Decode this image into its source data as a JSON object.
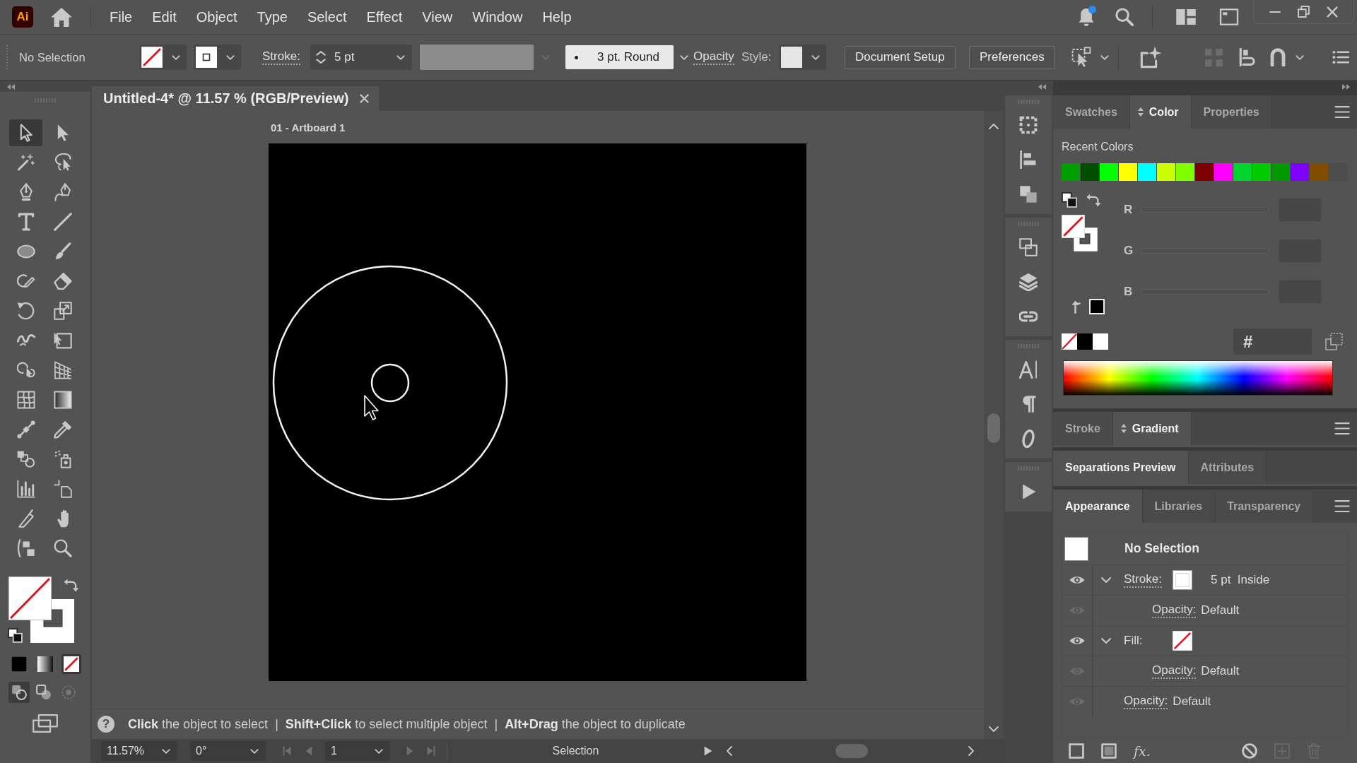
{
  "app_logo": "Ai",
  "menu_bar": {
    "items": [
      "File",
      "Edit",
      "Object",
      "Type",
      "Select",
      "Effect",
      "View",
      "Window",
      "Help"
    ]
  },
  "notifications": {
    "unread": true
  },
  "control_bar": {
    "selection": "No Selection",
    "stroke_label": "Stroke:",
    "stroke_weight": "5 pt",
    "brush": "3 pt. Round",
    "opacity_label": "Opacity",
    "style_label": "Style:",
    "buttons": [
      "Document Setup",
      "Preferences"
    ]
  },
  "document_tab": {
    "title": "Untitled-4* @ 11.57 % (RGB/Preview)"
  },
  "tools": [
    {
      "kind": "selection",
      "selected": true
    },
    {
      "kind": "direct_selection",
      "selected": false
    },
    {
      "kind": "magic_wand",
      "selected": false
    },
    {
      "kind": "lasso",
      "selected": false
    },
    {
      "kind": "pen",
      "selected": false
    },
    {
      "kind": "curvature",
      "selected": false
    },
    {
      "kind": "type",
      "selected": false
    },
    {
      "kind": "line",
      "selected": false
    },
    {
      "kind": "ellipse",
      "selected": false
    },
    {
      "kind": "paintbrush",
      "selected": false
    },
    {
      "kind": "shaper",
      "selected": false
    },
    {
      "kind": "eraser",
      "selected": false
    },
    {
      "kind": "rotate",
      "selected": false
    },
    {
      "kind": "scale",
      "selected": false
    },
    {
      "kind": "warp",
      "selected": false
    },
    {
      "kind": "free_transform",
      "selected": false
    },
    {
      "kind": "shape_builder",
      "selected": false
    },
    {
      "kind": "perspective_grid",
      "selected": false
    },
    {
      "kind": "mesh",
      "selected": false
    },
    {
      "kind": "gradient",
      "selected": false
    },
    {
      "kind": "width",
      "selected": false
    },
    {
      "kind": "eyedropper",
      "selected": false
    },
    {
      "kind": "blend",
      "selected": false
    },
    {
      "kind": "symbol_sprayer",
      "selected": false
    },
    {
      "kind": "column_graph",
      "selected": false
    },
    {
      "kind": "artboard",
      "selected": false
    },
    {
      "kind": "slice",
      "selected": false
    },
    {
      "kind": "hand",
      "selected": false
    },
    {
      "kind": "edit_toolbar",
      "selected": false
    },
    {
      "kind": "zoom",
      "selected": false
    }
  ],
  "color_modes": [
    {
      "kind": "color",
      "selected": false
    },
    {
      "kind": "gradient",
      "selected": false
    },
    {
      "kind": "none",
      "selected": true
    }
  ],
  "draw_modes": [
    {
      "kind": "normal",
      "selected": true
    },
    {
      "kind": "behind",
      "selected": false
    },
    {
      "kind": "inside",
      "selected": false
    }
  ],
  "artboard": {
    "label": "01 - Artboard 1"
  },
  "hint_bar": {
    "icon": "?",
    "text": "**Click** the object to select  |  **Shift+Click** to select multiple object  |  **Alt+Drag** the object to duplicate"
  },
  "status_bar": {
    "zoom": "11.57%",
    "rotation": "0°",
    "artboard": "1",
    "tool": "Selection"
  },
  "panels": [
    {
      "kind": "color",
      "has_menu": true,
      "tabs": [
        {
          "label": "Swatches",
          "selected": false,
          "options_toggle": false
        },
        {
          "label": "Color",
          "selected": true,
          "options_toggle": true
        },
        {
          "label": "Properties",
          "selected": false,
          "options_toggle": false
        }
      ],
      "recent_colors_label": "Recent Colors",
      "recent_colors": [
        {
          "color": "#009e00"
        },
        {
          "color": "#004d00"
        },
        {
          "color": "#00ff00"
        },
        {
          "color": "#ffff00"
        },
        {
          "color": "#00ffff"
        },
        {
          "color": "#ccff00"
        },
        {
          "color": "#80ff00"
        },
        {
          "color": "#800000"
        },
        {
          "color": "#ff00ff"
        },
        {
          "color": "#00d42e"
        },
        {
          "color": "#00cc00"
        },
        {
          "color": "#009900"
        },
        {
          "color": "#8000ff"
        },
        {
          "color": "#804d00"
        }
      ],
      "channels": [
        {
          "label": "R",
          "disabled": true
        },
        {
          "label": "G",
          "disabled": true
        },
        {
          "label": "B",
          "disabled": true
        }
      ],
      "hex_prefix": "#"
    },
    {
      "kind": "tabs_only",
      "has_menu": true,
      "tabs": [
        {
          "label": "Stroke",
          "selected": false,
          "options_toggle": false
        },
        {
          "label": "Gradient",
          "selected": true,
          "options_toggle": true
        }
      ]
    },
    {
      "kind": "tabs_only",
      "tabs": [
        {
          "label": "Separations Preview",
          "selected": true,
          "options_toggle": false
        },
        {
          "label": "Attributes",
          "selected": false,
          "options_toggle": false
        }
      ]
    },
    {
      "kind": "appearance",
      "has_menu": true,
      "tabs": [
        {
          "label": "Appearance",
          "selected": true,
          "options_toggle": false
        },
        {
          "label": "Libraries",
          "selected": false,
          "options_toggle": false
        },
        {
          "label": "Transparency",
          "selected": false,
          "options_toggle": false
        }
      ],
      "target": "No Selection",
      "rows": [
        {
          "label": "Stroke:",
          "link": true,
          "swatch": {
            "kind": "solid"
          },
          "value": "5 pt  Inside",
          "eye_active": true,
          "expanded": true,
          "children": [
            {
              "label": "Opacity:",
              "link": true,
              "value": "Default",
              "eye_active": false
            }
          ]
        },
        {
          "label": "Fill:",
          "link": false,
          "swatch": {
            "kind": "none"
          },
          "eye_active": true,
          "expanded": true,
          "children": [
            {
              "label": "Opacity:",
              "link": true,
              "value": "Default",
              "eye_active": false
            }
          ]
        },
        {
          "label": "Opacity:",
          "link": true,
          "value": "Default",
          "eye_active": false
        }
      ],
      "effects_button": "fx."
    }
  ]
}
